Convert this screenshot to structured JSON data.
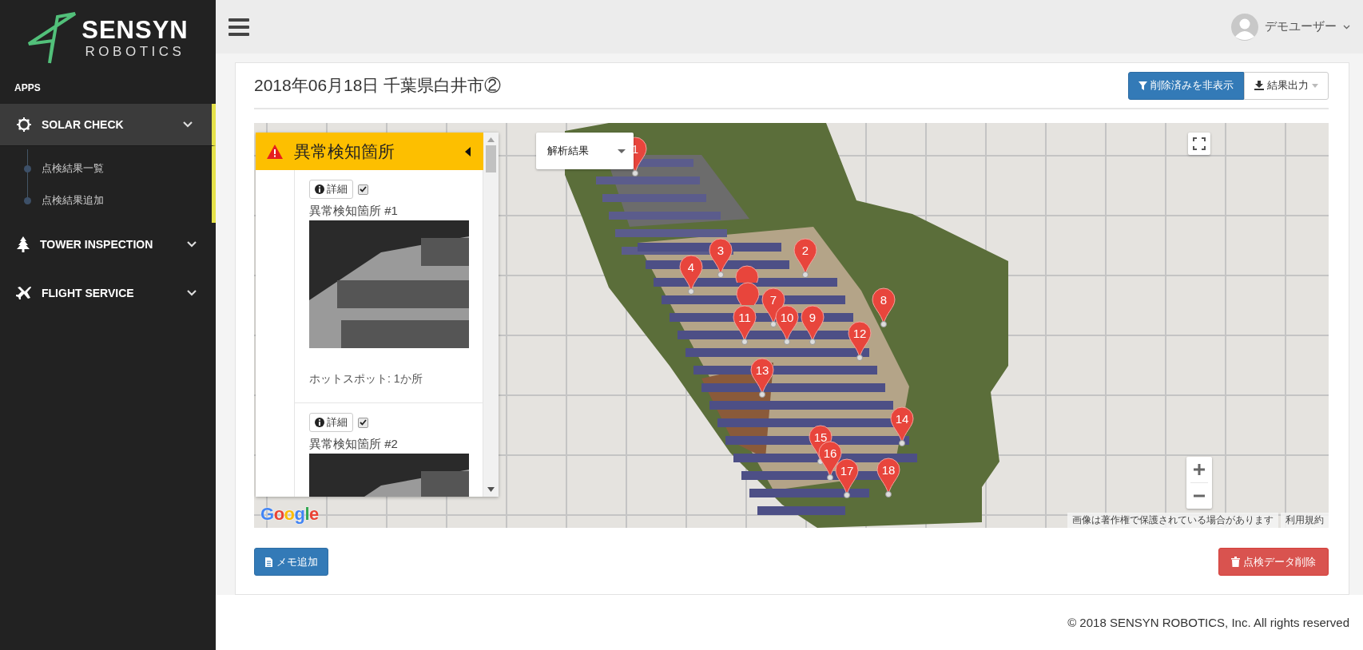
{
  "sidebar": {
    "logo": {
      "name": "SENSYN",
      "sub": "ROBOTICS"
    },
    "section": "APPS",
    "items": [
      {
        "label": "SOLAR CHECK",
        "selected": true,
        "children": [
          {
            "label": "点検結果一覧"
          },
          {
            "label": "点検結果追加"
          }
        ]
      },
      {
        "label": "TOWER INSPECTION",
        "selected": false
      },
      {
        "label": "FLIGHT SERVICE",
        "selected": false
      }
    ]
  },
  "header": {
    "user": "デモユーザー"
  },
  "page": {
    "title": "2018年06月18日 千葉県白井市②",
    "buttons": [
      {
        "label": "削除済みを非表示",
        "kind": "filter"
      },
      {
        "label": "結果出力",
        "kind": "export"
      }
    ]
  },
  "map": {
    "layer_select": "解析結果",
    "panel": {
      "title": "異常検知箇所",
      "items": [
        {
          "detail": "詳細",
          "checked": true,
          "title": "異常検知箇所 #1",
          "note": "ホットスポット: 1か所"
        },
        {
          "detail": "詳細",
          "checked": true,
          "title": "異常検知箇所 #2"
        }
      ]
    },
    "markers": [
      {
        "label": "1",
        "covered": false
      },
      {
        "label": "3",
        "covered": false
      },
      {
        "label": "2",
        "covered": false
      },
      {
        "label": "4",
        "covered": false
      },
      {
        "covered": true
      },
      {
        "covered": true
      },
      {
        "label": "7",
        "covered": false
      },
      {
        "label": "8",
        "covered": false
      },
      {
        "label": "11",
        "covered": false
      },
      {
        "label": "10",
        "covered": false
      },
      {
        "label": "9",
        "covered": false
      },
      {
        "label": "12",
        "covered": false
      },
      {
        "label": "13",
        "covered": false
      },
      {
        "label": "14",
        "covered": false
      },
      {
        "label": "15",
        "covered": false
      },
      {
        "label": "16",
        "covered": false
      },
      {
        "label": "17",
        "covered": false
      },
      {
        "label": "18",
        "covered": false
      }
    ],
    "provider": "Google",
    "attribution": [
      "画像は著作権で保護されている場合があります",
      "利用規約"
    ]
  },
  "actions": {
    "memo": "メモ追加",
    "delete": "点検データ削除"
  },
  "footer": "© 2018 SENSYN ROBOTICS, Inc. All rights reserved"
}
